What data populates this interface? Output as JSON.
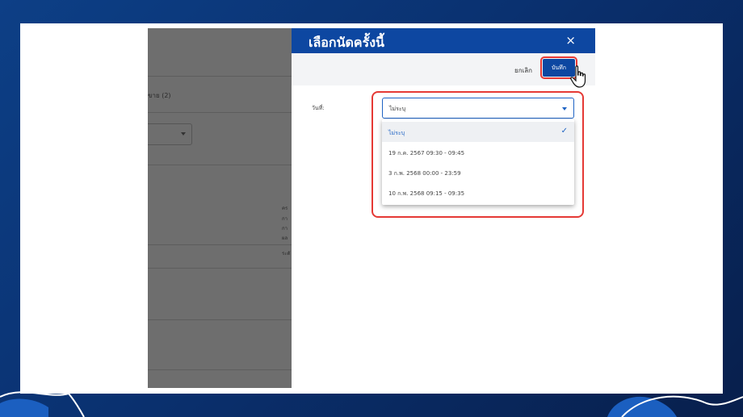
{
  "background": {
    "tab_label": "ขาย (2)",
    "text_lines": [
      "คร",
      "กา",
      "กา",
      "ผล",
      "ระดั"
    ]
  },
  "dialog": {
    "title": "เลือกนัดครั้งนี้",
    "close_icon": "×",
    "cancel_label": "ยกเลิก",
    "save_label": "บันทึก",
    "date_label": "วันที่:",
    "selected_value": "ไม่ระบุ",
    "options": [
      {
        "label": "ไม่ระบุ",
        "selected": true
      },
      {
        "label": "19 ก.ค. 2567 09:30 - 09:45",
        "selected": false
      },
      {
        "label": "3 ก.พ. 2568 00:00 - 23:59",
        "selected": false
      },
      {
        "label": "10 ก.พ. 2568 09:15 - 09:35",
        "selected": false
      }
    ],
    "check_icon": "✓"
  },
  "colors": {
    "header": "#0d47a1",
    "highlight": "#e53935",
    "accent": "#1e63c4"
  }
}
